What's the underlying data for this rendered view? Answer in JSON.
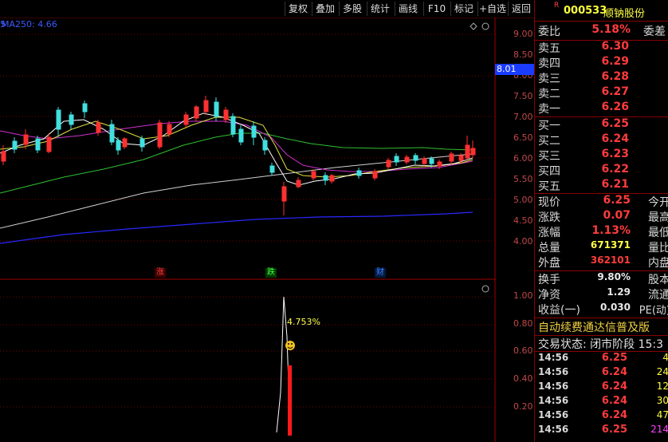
{
  "toolbar": {
    "buttons": [
      "复权",
      "叠加",
      "多股",
      "统计",
      "画线",
      "F10",
      "标记",
      "+自选",
      "返回"
    ]
  },
  "chart": {
    "ma_label": "MA250: 4.66",
    "corner_mark": "5",
    "price_axis": [
      "9.00",
      "8.50",
      "8.00",
      "7.50",
      "7.00",
      "6.50",
      "6.00",
      "5.50",
      "5.00",
      "4.50",
      "4.00"
    ],
    "current_price_tag": "8.01",
    "indicator_axis": [
      "1.00",
      "0.80",
      "0.60",
      "0.40",
      "0.20"
    ],
    "markers": [
      {
        "text": "涨",
        "color": "#ff4040"
      },
      {
        "text": "跌",
        "color": "#40ff40"
      },
      {
        "text": "财",
        "color": "#4080ff"
      }
    ],
    "indicator_annotation": "4.753%"
  },
  "quote": {
    "badge": "R",
    "code": "000533",
    "name": "顺钠股份",
    "weibi_label": "委比",
    "weibi_value": "5.18%",
    "weicha_label": "委差",
    "asks": [
      {
        "label": "卖五",
        "price": "6.30"
      },
      {
        "label": "卖四",
        "price": "6.29"
      },
      {
        "label": "卖三",
        "price": "6.28"
      },
      {
        "label": "卖二",
        "price": "6.27"
      },
      {
        "label": "卖一",
        "price": "6.26"
      }
    ],
    "bids": [
      {
        "label": "买一",
        "price": "6.25"
      },
      {
        "label": "买二",
        "price": "6.24"
      },
      {
        "label": "买三",
        "price": "6.23"
      },
      {
        "label": "买四",
        "price": "6.22"
      },
      {
        "label": "买五",
        "price": "6.21"
      }
    ],
    "stats1": [
      {
        "label": "现价",
        "value": "6.25",
        "tail": "今开",
        "color": "red"
      },
      {
        "label": "涨跌",
        "value": "0.07",
        "tail": "最高",
        "color": "red"
      },
      {
        "label": "涨幅",
        "value": "1.13%",
        "tail": "最低",
        "color": "red"
      },
      {
        "label": "总量",
        "value": "671371",
        "tail": "量比",
        "color": "yellow"
      },
      {
        "label": "外盘",
        "value": "362101",
        "tail": "内盘",
        "color": "red"
      }
    ],
    "stats2": [
      {
        "label": "换手",
        "value": "9.80%",
        "tail": "股本",
        "color": "white"
      },
      {
        "label": "净资",
        "value": "1.29",
        "tail": "流通",
        "color": "white"
      },
      {
        "label": "收益(一)",
        "value": "0.030",
        "tail": "PE(动)",
        "color": "white"
      }
    ],
    "promo": "自动续费通达信普及版",
    "trade_status": "交易状态: 闭市阶段 15:3",
    "ticks": [
      {
        "time": "14:56",
        "price": "6.25",
        "qty": "4"
      },
      {
        "time": "14:56",
        "price": "6.24",
        "qty": "24"
      },
      {
        "time": "14:56",
        "price": "6.24",
        "qty": "12"
      },
      {
        "time": "14:56",
        "price": "6.24",
        "qty": "30"
      },
      {
        "time": "14:56",
        "price": "6.24",
        "qty": "47"
      },
      {
        "time": "14:56",
        "price": "6.25",
        "qty": "214"
      }
    ]
  }
}
